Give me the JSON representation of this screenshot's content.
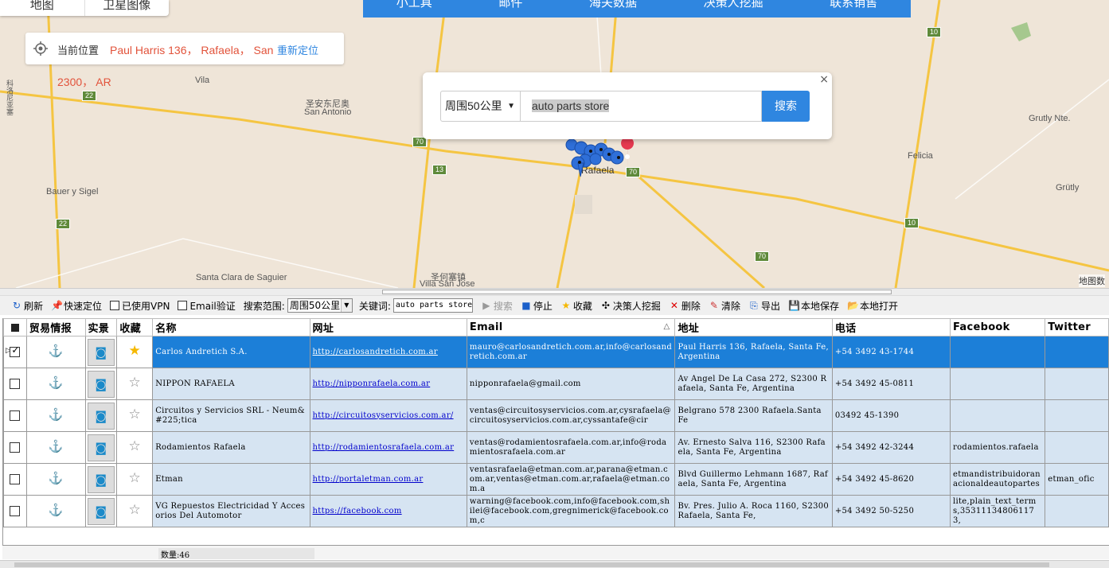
{
  "map": {
    "tabs": [
      "地图",
      "卫星图像"
    ],
    "nav": [
      "小工具",
      "邮件",
      "海关数据",
      "决策人挖掘",
      "联系销售"
    ],
    "location_label": "当前位置",
    "location_address": "Paul Harris 136， Rafaela， San",
    "location_address_2": "2300， AR",
    "relocate": "重新定位",
    "places": [
      "Vila",
      "圣安东尼奥",
      "San Antonio",
      "Bauer y Sigel",
      "Rafaela",
      "圣何塞镇",
      "Villa San Jose",
      "Santa Clara de Saguier",
      "Grutly Nte.",
      "Felicia",
      "Grütly",
      "科洛尼亚塞"
    ],
    "roads": [
      "22",
      "22",
      "70",
      "13",
      "70",
      "70",
      "10",
      "10"
    ],
    "attribution": "地图数",
    "search_popup": {
      "close": "×",
      "range": "周围50公里",
      "query": "auto parts store",
      "button": "搜索"
    }
  },
  "toolbar": {
    "refresh": "刷新",
    "quick_locate": "快速定位",
    "vpn": "已使用VPN",
    "email_verify": "Email验证",
    "range_label": "搜索范围:",
    "range_value": "周围50公里",
    "keyword_label": "关键词:",
    "keyword_value": "auto parts store",
    "search": "搜索",
    "stop": "停止",
    "favorite": "收藏",
    "decision_maker": "决策人挖掘",
    "delete": "删除",
    "clear": "清除",
    "export": "导出",
    "save_local": "本地保存",
    "open_local": "本地打开"
  },
  "table": {
    "headers": [
      "贸易情报",
      "实景",
      "收藏",
      "名称",
      "网址",
      "Email",
      "地址",
      "电话",
      "Facebook",
      "Twitter"
    ],
    "rows": [
      {
        "checked": true,
        "anchor_red": true,
        "fav": true,
        "name": "Carlos Andretich S.A.",
        "url": "http://carlosandretich.com.ar",
        "email": "mauro@carlosandretich.com.ar,info@carlosandretich.com.ar",
        "address": "Paul Harris 136, Rafaela, Santa Fe, Argentina",
        "phone": "+54 3492 43-1744",
        "facebook": "",
        "twitter": ""
      },
      {
        "checked": false,
        "anchor_red": false,
        "fav": false,
        "name": "NIPPON RAFAELA",
        "url": "http://nipponrafaela.com.ar",
        "email": "nipponrafaela@gmail.com",
        "address": "Av Angel De La Casa 272, S2300 Rafaela, Santa Fe, Argentina",
        "phone": "+54 3492 45-0811",
        "facebook": "",
        "twitter": ""
      },
      {
        "checked": false,
        "anchor_red": false,
        "fav": false,
        "name": "Circuitos y Servicios SRL - Neum&#225;tica",
        "url": "http://circuitosyservicios.com.ar/",
        "email": "ventas@circuitosyservicios.com.ar,cysrafaela@circuitosyservicios.com.ar,cyssantafe@cir",
        "address": "Belgrano 578 2300 Rafaela.Santa Fe",
        "phone": "03492 45-1390",
        "facebook": "",
        "twitter": ""
      },
      {
        "checked": false,
        "anchor_red": false,
        "fav": false,
        "name": "Rodamientos Rafaela",
        "url": "http://rodamientosrafaela.com.ar",
        "email": "ventas@rodamientosrafaela.com.ar,info@rodamientosrafaela.com.ar",
        "address": "Av. Ernesto Salva 116, S2300 Rafaela, Santa Fe, Argentina",
        "phone": "+54 3492 42-3244",
        "facebook": "rodamientos.rafaela",
        "twitter": ""
      },
      {
        "checked": false,
        "anchor_red": true,
        "fav": false,
        "name": "Etman",
        "url": "http://portaletman.com.ar",
        "email": "ventasrafaela@etman.com.ar,parana@etman.com.ar,ventas@etman.com.ar,rafaela@etman.com.a",
        "address": "Blvd Guillermo Lehmann 1687, Rafaela, Santa Fe, Argentina",
        "phone": "+54 3492 45-8620",
        "facebook": "etmandistribuidoranacionaldeautopartes",
        "twitter": "etman_ofic"
      },
      {
        "checked": false,
        "anchor_red": false,
        "fav": false,
        "name": "VG Repuestos Electricidad Y Accesorios Del Automotor",
        "url": "https://facebook.com",
        "email": "warning@facebook.com,info@facebook.com,shilei@facebook.com,gregnimerick@facebook.com,c",
        "address": "Bv. Pres. Julio A. Roca 1160, S2300 Rafaela, Santa Fe,",
        "phone": "+54 3492 50-5250",
        "facebook": "lite,plain_text_terms,353111348061173,",
        "twitter": ""
      }
    ]
  },
  "footer": {
    "count": "数量:46"
  },
  "colors": {
    "accent": "#2f86e0",
    "selected_row": "#1c7fd8",
    "row_bg": "#d6e4f2",
    "address_red": "#e2533b"
  }
}
